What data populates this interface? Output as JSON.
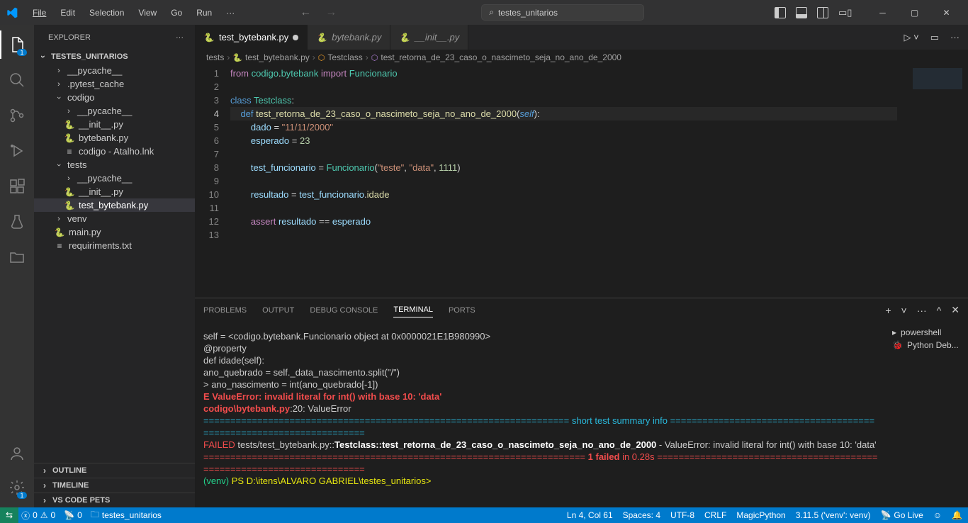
{
  "titlebar": {
    "menus": [
      "File",
      "Edit",
      "Selection",
      "View",
      "Go",
      "Run"
    ],
    "search_text": "testes_unitarios"
  },
  "activity": {
    "explorer_badge": "1",
    "settings_badge": "1"
  },
  "sidebar": {
    "title": "EXPLORER",
    "project": "TESTES_UNITARIOS",
    "tree": {
      "pycache": "__pycache__",
      "pytest_cache": ".pytest_cache",
      "codigo": "codigo",
      "codigo_pycache": "__pycache__",
      "codigo_init": "__init__.py",
      "codigo_bytebank": "bytebank.py",
      "codigo_atalho": "codigo - Atalho.lnk",
      "tests": "tests",
      "tests_pycache": "__pycache__",
      "tests_init": "__init__.py",
      "tests_file": "test_bytebank.py",
      "venv": "venv",
      "main": "main.py",
      "requirements": "requiriments.txt"
    },
    "collapsed": {
      "outline": "OUTLINE",
      "timeline": "TIMELINE",
      "pets": "VS CODE PETS"
    }
  },
  "tabs": {
    "t1": "test_bytebank.py",
    "t2": "bytebank.py",
    "t3": "__init__.py"
  },
  "breadcrumbs": {
    "b1": "tests",
    "b2": "test_bytebank.py",
    "b3": "Testclass",
    "b4": "test_retorna_de_23_caso_o_nascimeto_seja_no_ano_de_2000"
  },
  "code": {
    "line_numbers": [
      "1",
      "2",
      "3",
      "4",
      "5",
      "6",
      "7",
      "8",
      "9",
      "10",
      "11",
      "12",
      "13"
    ],
    "l1": {
      "from": "from",
      "codigo": "codigo",
      "dot": ".",
      "bytebank": "bytebank",
      "import": "import",
      "func": "Funcionario"
    },
    "l3": {
      "class": "class",
      "name": "Testclass",
      "colon": ":"
    },
    "l4": {
      "def": "def",
      "name": "test_retorna_de_23_caso_o_nascimeto_seja_no_ano_de_2000",
      "p1": "(",
      "self": "self",
      "p2": ")",
      "colon": ":"
    },
    "l5": {
      "var": "dado",
      "eq": "=",
      "val": "\"11/11/2000\""
    },
    "l6": {
      "var": "esperado",
      "eq": "=",
      "val": "23"
    },
    "l8": {
      "var": "test_funcionario",
      "eq": "=",
      "cls": "Funcionario",
      "p1": "(",
      "a1": "\"teste\"",
      "c": ",",
      "a2": "\"data\"",
      "c2": ",",
      "a3": "1111",
      "p2": ")"
    },
    "l10": {
      "var": "resultado",
      "eq": "=",
      "obj": "test_funcionario",
      "dot": ".",
      "fn": "idade"
    },
    "l12": {
      "assert": "assert",
      "r": "resultado",
      "eq": "==",
      "e": "esperado"
    }
  },
  "panel": {
    "tabs": {
      "problems": "PROBLEMS",
      "output": "OUTPUT",
      "debug": "DEBUG CONSOLE",
      "terminal": "TERMINAL",
      "ports": "PORTS"
    },
    "terminals": {
      "t1": "powershell",
      "t2": "Python Deb..."
    }
  },
  "terminal": {
    "l1": "self = <codigo.bytebank.Funcionario object at 0x0000021E1B980990>",
    "l2": "    @property",
    "l3": "    def idade(self):",
    "l4": "        ano_quebrado = self._data_nascimento.split(\"/\")",
    "l5a": ">       ano_nascimento = int(ano_quebrado[-1])",
    "l5b": "E       ValueError: invalid literal for int() with base 10: 'data'",
    "l6a": "codigo\\bytebank.py",
    "l6b": ":20: ValueError",
    "eq_left": "====================================================================",
    "summary": " short test summary info ",
    "eq_right": "====================================================================",
    "failed": "FAILED",
    "test_path": " tests/test_bytebank.py::",
    "test_name": "Testclass::test_retorna_de_23_caso_o_nascimeto_seja_no_ano_de_2000",
    "err": " - ValueError: invalid literal for int() with base 10: 'data'",
    "eq2_left": "=======================================================================",
    "failed1": " 1 failed",
    "in028": " in 0.28s",
    "eq2_right": " =======================================================================",
    "venv": "(venv)",
    "prompt": " PS D:\\itens\\ALVARO GABRIEL\\testes_unitarios> "
  },
  "status": {
    "errors": "0",
    "warnings": "0",
    "ports": "0",
    "folder": "testes_unitarios",
    "cursor": "Ln 4, Col 61",
    "spaces": "Spaces: 4",
    "encoding": "UTF-8",
    "eol": "CRLF",
    "lang": "MagicPython",
    "py": "3.11.5 ('venv': venv)",
    "golive": "Go Live"
  }
}
